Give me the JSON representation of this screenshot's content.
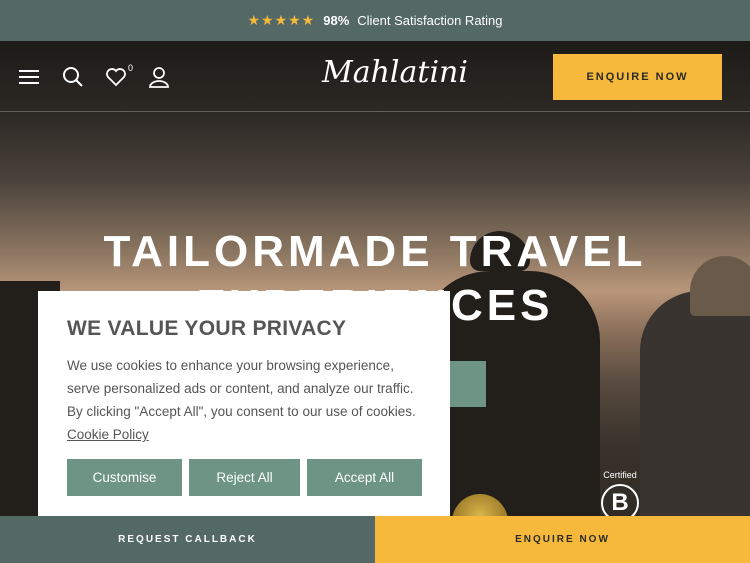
{
  "topbar": {
    "stars": "★★★★★",
    "rating_value": "98%",
    "rating_text": "Client Satisfaction Rating"
  },
  "header": {
    "logo": "Mahlatini",
    "wishlist_count": "0",
    "enquire_label": "ENQUIRE NOW"
  },
  "hero": {
    "title_line1": "TAILORMADE TRAVEL",
    "title_line2": "EXPERIENCES"
  },
  "certification": {
    "label": "Certified",
    "badge": "B"
  },
  "cookie": {
    "title": "WE VALUE YOUR PRIVACY",
    "body": "We use cookies to enhance your browsing experience, serve personalized ads or content, and analyze our traffic. By clicking \"Accept All\", you consent to our use of cookies.",
    "policy_link": "Cookie Policy",
    "customise_label": "Customise",
    "reject_label": "Reject All",
    "accept_label": "Accept All"
  },
  "bottombar": {
    "callback_label": "REQUEST CALLBACK",
    "enquire_label": "ENQUIRE NOW"
  },
  "colors": {
    "accent": "#f6b93b",
    "slate": "#546866",
    "sage": "#6e9486"
  }
}
